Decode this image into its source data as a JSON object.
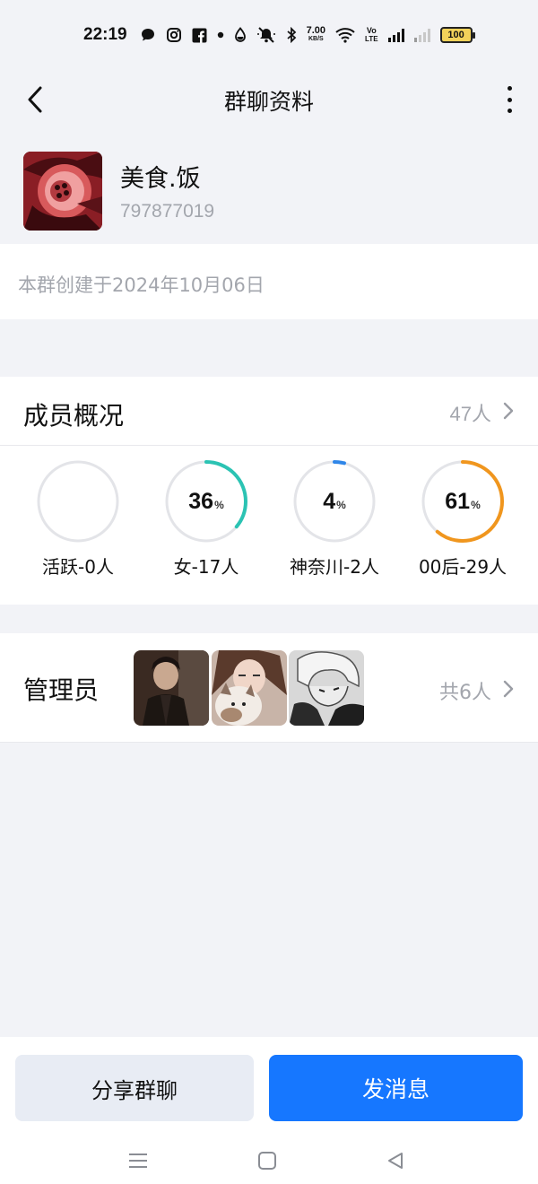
{
  "status_bar": {
    "time": "22:19",
    "network_speed_value": "7.00",
    "network_speed_unit": "KB/S",
    "volte_top": "Vo",
    "volte_bottom": "LTE",
    "battery": "100"
  },
  "header": {
    "title": "群聊资料"
  },
  "group": {
    "name": "美食.饭",
    "id": "797877019",
    "created_text": "本群创建于2024年10月06日"
  },
  "members": {
    "title": "成员概况",
    "count": "47人",
    "stats": [
      {
        "value": "",
        "pct_symbol": "",
        "percent": 0,
        "label": "活跃-0人",
        "color": "#2bc3b3"
      },
      {
        "value": "36",
        "pct_symbol": "%",
        "percent": 36,
        "label": "女-17人",
        "color": "#2bc3b3"
      },
      {
        "value": "4",
        "pct_symbol": "%",
        "percent": 4,
        "label": "神奈川-2人",
        "color": "#2f86e8"
      },
      {
        "value": "61",
        "pct_symbol": "%",
        "percent": 61,
        "label": "00后-29人",
        "color": "#f0961e"
      }
    ]
  },
  "admins": {
    "title": "管理员",
    "count": "共6人"
  },
  "actions": {
    "share_label": "分享群聊",
    "send_label": "发消息"
  },
  "colors": {
    "primary": "#1677ff",
    "background": "#f2f3f7",
    "muted_text": "#a3a6ad"
  }
}
